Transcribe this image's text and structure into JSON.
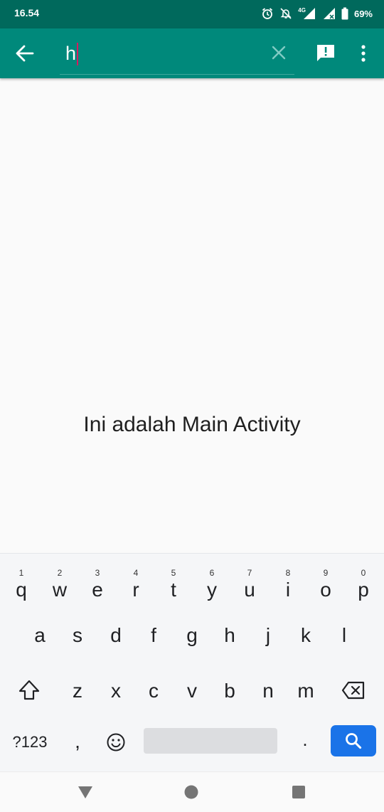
{
  "status_bar": {
    "time": "16.54",
    "network_label": "4G",
    "battery_percent": "69%",
    "icons": [
      "alarm-icon",
      "notifications-off-icon",
      "signal-4g-icon",
      "signal-icon",
      "battery-icon"
    ]
  },
  "toolbar": {
    "search_value": "h",
    "back_icon": "arrow-left-icon",
    "clear_icon": "close-icon",
    "feedback_icon": "feedback-icon",
    "menu_icon": "more-vert-icon",
    "background": "#00897b"
  },
  "main": {
    "text": "Ini adalah Main Activity"
  },
  "keyboard": {
    "row1": [
      {
        "hint": "1",
        "key": "q"
      },
      {
        "hint": "2",
        "key": "w"
      },
      {
        "hint": "3",
        "key": "e"
      },
      {
        "hint": "4",
        "key": "r"
      },
      {
        "hint": "5",
        "key": "t"
      },
      {
        "hint": "6",
        "key": "y"
      },
      {
        "hint": "7",
        "key": "u"
      },
      {
        "hint": "8",
        "key": "i"
      },
      {
        "hint": "9",
        "key": "o"
      },
      {
        "hint": "0",
        "key": "p"
      }
    ],
    "row2": [
      "a",
      "s",
      "d",
      "f",
      "g",
      "h",
      "j",
      "k",
      "l"
    ],
    "row3": [
      "z",
      "x",
      "c",
      "v",
      "b",
      "n",
      "m"
    ],
    "symbols_label": "?123",
    "comma_label": ",",
    "period_label": ".",
    "action_color": "#1a73e8"
  },
  "nav_bar": {
    "icons": [
      "nav-back-icon",
      "nav-home-icon",
      "nav-recents-icon"
    ]
  }
}
